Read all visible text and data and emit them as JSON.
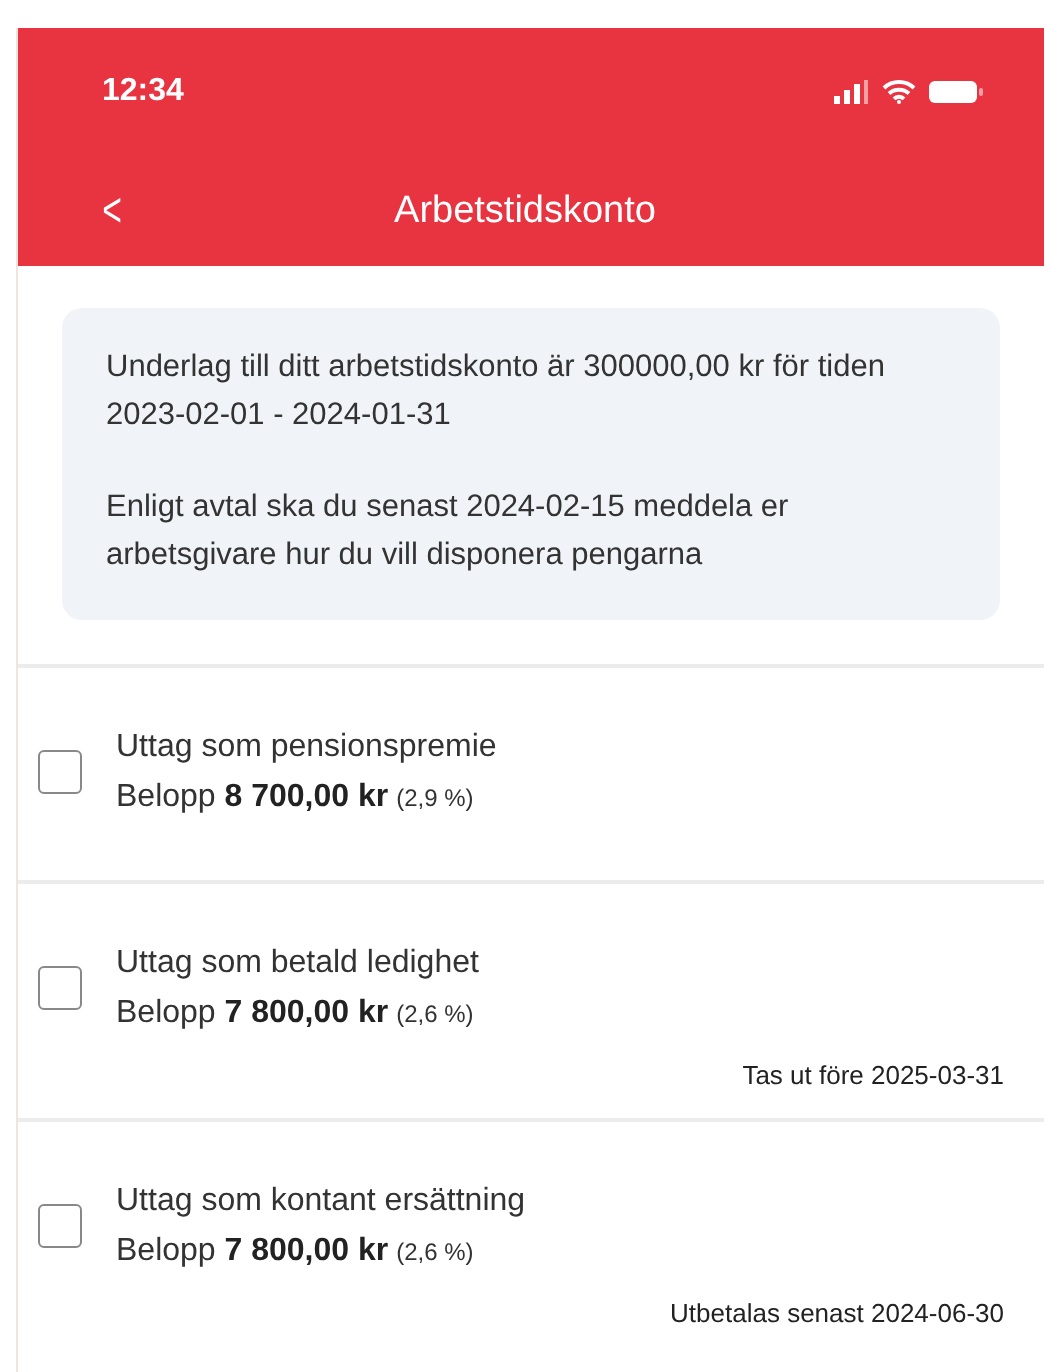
{
  "status_bar": {
    "time": "12:34"
  },
  "header": {
    "back": "<",
    "title": "Arbetstidskonto"
  },
  "info": [
    "Underlag till ditt arbetstidskonto är 300000,00 kr för tiden 2023-02-01 - 2024-01-31",
    "Enligt avtal ska du senast 2024-02-15 meddela er arbetsgivare hur du vill disponera pengarna"
  ],
  "options": [
    {
      "title": "Uttag som pensionspremie",
      "amount": "Belopp **8 700,00 kr**",
      "percent": "(2,9 %)",
      "checked": false
    },
    {
      "title": "Uttag som betald ledighet",
      "amount": "Belopp **7 800,00 kr**",
      "percent": "(2,6 %)",
      "note": "Tas ut före 2025-03-31",
      "checked": false
    },
    {
      "title": "Uttag som kontant ersättning",
      "amount": "Belopp **7 800,00 kr**",
      "percent": "(2,6 %)",
      "note": "Utbetalas senast 2024-06-30",
      "checked": false
    }
  ]
}
